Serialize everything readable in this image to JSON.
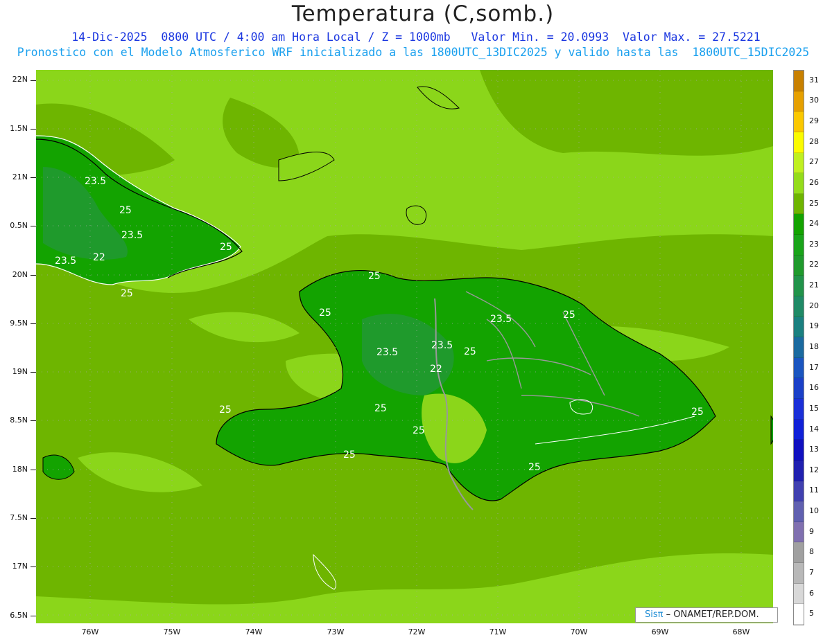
{
  "header": {
    "title": "Temperatura (C,somb.)",
    "subtitle1": "14-Dic-2025  0800 UTC / 4:00 am Hora Local / Z = 1000mb   Valor Min. = 20.0993  Valor Max. = 27.5221",
    "subtitle2": "Pronostico con el Modelo Atmosferico WRF inicializado a las 1800UTC_13DIC2025 y valido hasta las  1800UTC_15DIC2025"
  },
  "axes": {
    "lat_labels": [
      "22N",
      "1.5N",
      "21N",
      "0.5N",
      "20N",
      "9.5N",
      "19N",
      "8.5N",
      "18N",
      "7.5N",
      "17N",
      "6.5N"
    ],
    "lon_labels": [
      "76W",
      "75W",
      "74W",
      "73W",
      "72W",
      "71W",
      "70W",
      "69W",
      "68W"
    ]
  },
  "colorbar": {
    "levels": [
      "31",
      "30",
      "29",
      "28",
      "27",
      "26",
      "25",
      "24",
      "23",
      "22",
      "21",
      "20",
      "19",
      "18",
      "17",
      "16",
      "15",
      "14",
      "13",
      "12",
      "11",
      "10",
      "9",
      "8",
      "7",
      "6",
      "5"
    ],
    "colors": [
      "#c88000",
      "#e6a000",
      "#fbc800",
      "#fbfb00",
      "#c0f020",
      "#94dc1a",
      "#6eb500",
      "#13a300",
      "#19a419",
      "#1f9a2c",
      "#21934a",
      "#1f8a66",
      "#1a8080",
      "#1a6aa0",
      "#1a55c0",
      "#1a40c8",
      "#1a2fd8",
      "#1020d8",
      "#1010c0",
      "#2020b0",
      "#4040b0",
      "#6060b0",
      "#8070b0",
      "#a0a0a0",
      "#b8b8b8",
      "#d8d8d8",
      "#ffffff"
    ]
  },
  "contour_labels": [
    "23.5",
    "25",
    "23.5",
    "23.5",
    "22",
    "25",
    "25",
    "25",
    "23.5",
    "25",
    "23.5",
    "23.5",
    "22",
    "25",
    "25",
    "25",
    "25",
    "25",
    "25",
    "25",
    "25"
  ],
  "credit": {
    "logo": "Sisπ",
    "text": " – ONAMET/REP.DOM."
  },
  "colors": {
    "ocean": "#8bd61a",
    "band": "#6eb500",
    "land_25": "#13a300",
    "land_24": "#19a419",
    "land_23": "#1f9a2c",
    "coast": "#000000",
    "provinces": "#999999",
    "isotherm": "#ffffff"
  }
}
